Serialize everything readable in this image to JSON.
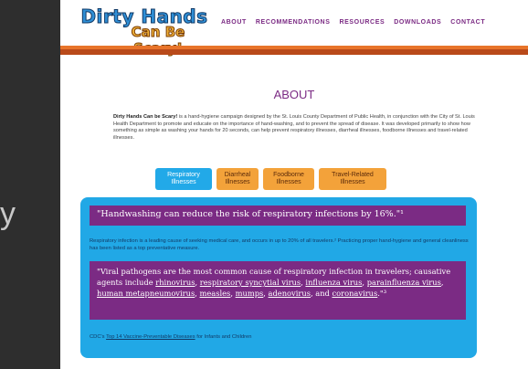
{
  "background": {
    "glyph": "y"
  },
  "logo": {
    "line1": "Dirty Hands",
    "line2": "Can Be Scary!"
  },
  "nav": {
    "items": [
      "ABOUT",
      "RECOMMENDATIONS",
      "RESOURCES",
      "DOWNLOADS",
      "CONTACT"
    ]
  },
  "page": {
    "title": "ABOUT",
    "intro_bold": "Dirty Hands Can be Scary!",
    "intro_rest": " is a hand-hygiene campaign designed by the St. Louis County Department of Public Health, in conjunction with the City of St. Louis Health Department to promote and educate on the importance of hand-washing, and to prevent the spread of disease. It was developed primarily to show how something as simple as washing your hands for 20 seconds, can help prevent respiratory illnesses, diarrheal illnesses, foodborne illnesses and travel-related illnesses."
  },
  "tabs": [
    {
      "label": "Respiratory Illnesses",
      "active": true
    },
    {
      "label": "Diarrheal Illnesses",
      "active": false
    },
    {
      "label": "Foodborne Illnesses",
      "active": false
    },
    {
      "label": "Travel-Related Illnesses",
      "active": false
    }
  ],
  "panel": {
    "quote1": "\"Handwashing can reduce the risk of respiratory infections by 16%.\"¹",
    "paragraph": "Respiratory infection is a leading cause of seeking medical care, and occurs in up to 20% of all travelers.² Practicing proper hand-hygiene and general cleanliness has been listed as a top preventative measure.",
    "quote2_start": "\"Viral pathogens are the most common cause of respiratory infection in travelers; causative agents include ",
    "links": [
      "rhinovirus",
      "respiratory syncytial virus",
      "influenza virus",
      "parainfluenza virus",
      "human metapneumovirus",
      "measles",
      "mumps",
      "adenovirus",
      "coronavirus"
    ],
    "sep1": ", ",
    "sep_and": ", and ",
    "quote2_end": ".\"³",
    "cdc_prefix": "CDC's ",
    "cdc_link": "Top 14 Vaccine-Preventable Diseases",
    "cdc_suffix": " for Infants and Children"
  },
  "colors": {
    "purple": "#7b2b84",
    "blue": "#21a8e6",
    "orange": "#f3a23a",
    "header_orange": "#e8742a"
  }
}
